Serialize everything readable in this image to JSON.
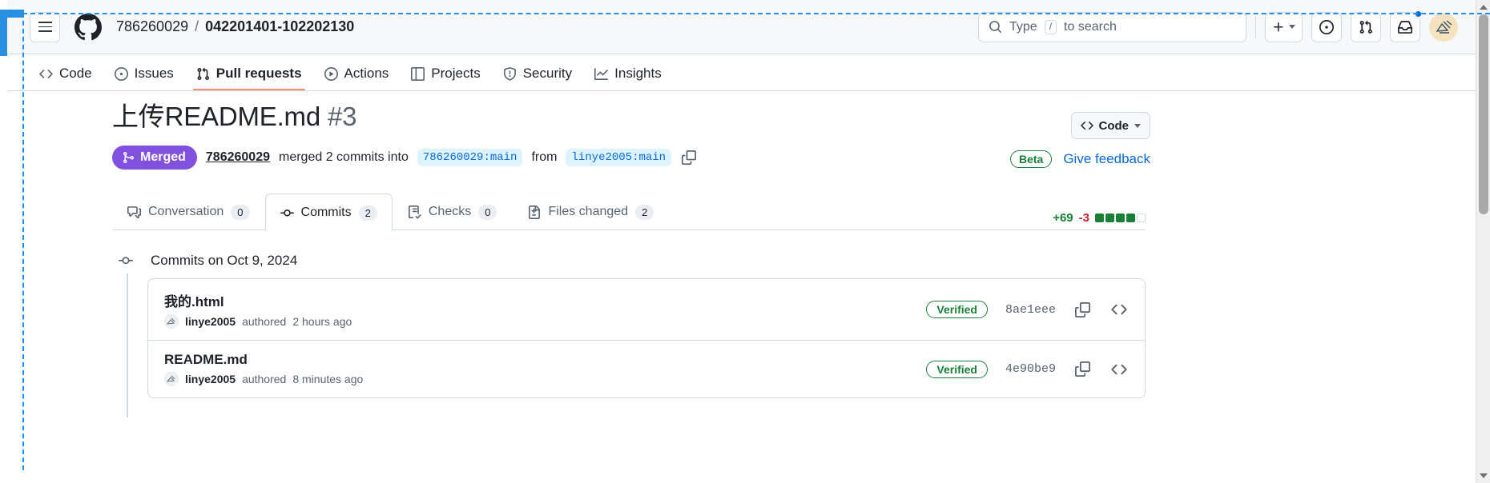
{
  "header": {
    "breadcrumb": {
      "owner": "786260029",
      "separator": "/",
      "repo": "042201401-102202130"
    },
    "search": {
      "prefix": "Type",
      "key": "/",
      "suffix": "to search",
      "placeholder": "Type / to search"
    },
    "actions": {
      "create_label": "+",
      "issues_label": "Issues",
      "pulls_label": "Pull requests",
      "inbox_label": "Notifications"
    }
  },
  "repo_nav": {
    "items": [
      {
        "label": "Code",
        "icon": "code-icon",
        "active": false
      },
      {
        "label": "Issues",
        "icon": "issue-opened-icon",
        "active": false
      },
      {
        "label": "Pull requests",
        "icon": "git-pull-request-icon",
        "active": true
      },
      {
        "label": "Actions",
        "icon": "play-icon",
        "active": false
      },
      {
        "label": "Projects",
        "icon": "table-icon",
        "active": false
      },
      {
        "label": "Security",
        "icon": "shield-icon",
        "active": false
      },
      {
        "label": "Insights",
        "icon": "graph-icon",
        "active": false
      }
    ]
  },
  "pull_request": {
    "title": "上传README.md",
    "number": "#3",
    "code_button": "Code",
    "state": "Merged",
    "merge_author": "786260029",
    "merge_text_1": "merged 2 commits into",
    "base_branch": "786260029:main",
    "merge_text_2": "from",
    "head_branch": "linye2005:main",
    "beta_badge": "Beta",
    "feedback_link": "Give feedback"
  },
  "tabs": [
    {
      "label": "Conversation",
      "count": "0",
      "icon": "comment-discussion-icon",
      "active": false
    },
    {
      "label": "Commits",
      "count": "2",
      "icon": "git-commit-icon",
      "active": true
    },
    {
      "label": "Checks",
      "count": "0",
      "icon": "checklist-icon",
      "active": false
    },
    {
      "label": "Files changed",
      "count": "2",
      "icon": "file-diff-icon",
      "active": false
    }
  ],
  "diffstat": {
    "additions": "+69",
    "deletions": "-3",
    "blocks_on": 4,
    "blocks_off": 1
  },
  "commits": {
    "date_heading": "Commits on Oct 9, 2024",
    "rows": [
      {
        "message": "我的.html",
        "author": "linye2005",
        "authored_text": "authored",
        "time": "2 hours ago",
        "verified": "Verified",
        "sha": "8ae1eee"
      },
      {
        "message": "README.md",
        "author": "linye2005",
        "authored_text": "authored",
        "time": "8 minutes ago",
        "verified": "Verified",
        "sha": "4e90be9"
      }
    ]
  },
  "colors": {
    "merged_purple": "#8250df",
    "link_blue": "#0969da",
    "success_green": "#1a7f37",
    "danger_red": "#cf222e",
    "active_tab_underline": "#fd8c73"
  }
}
